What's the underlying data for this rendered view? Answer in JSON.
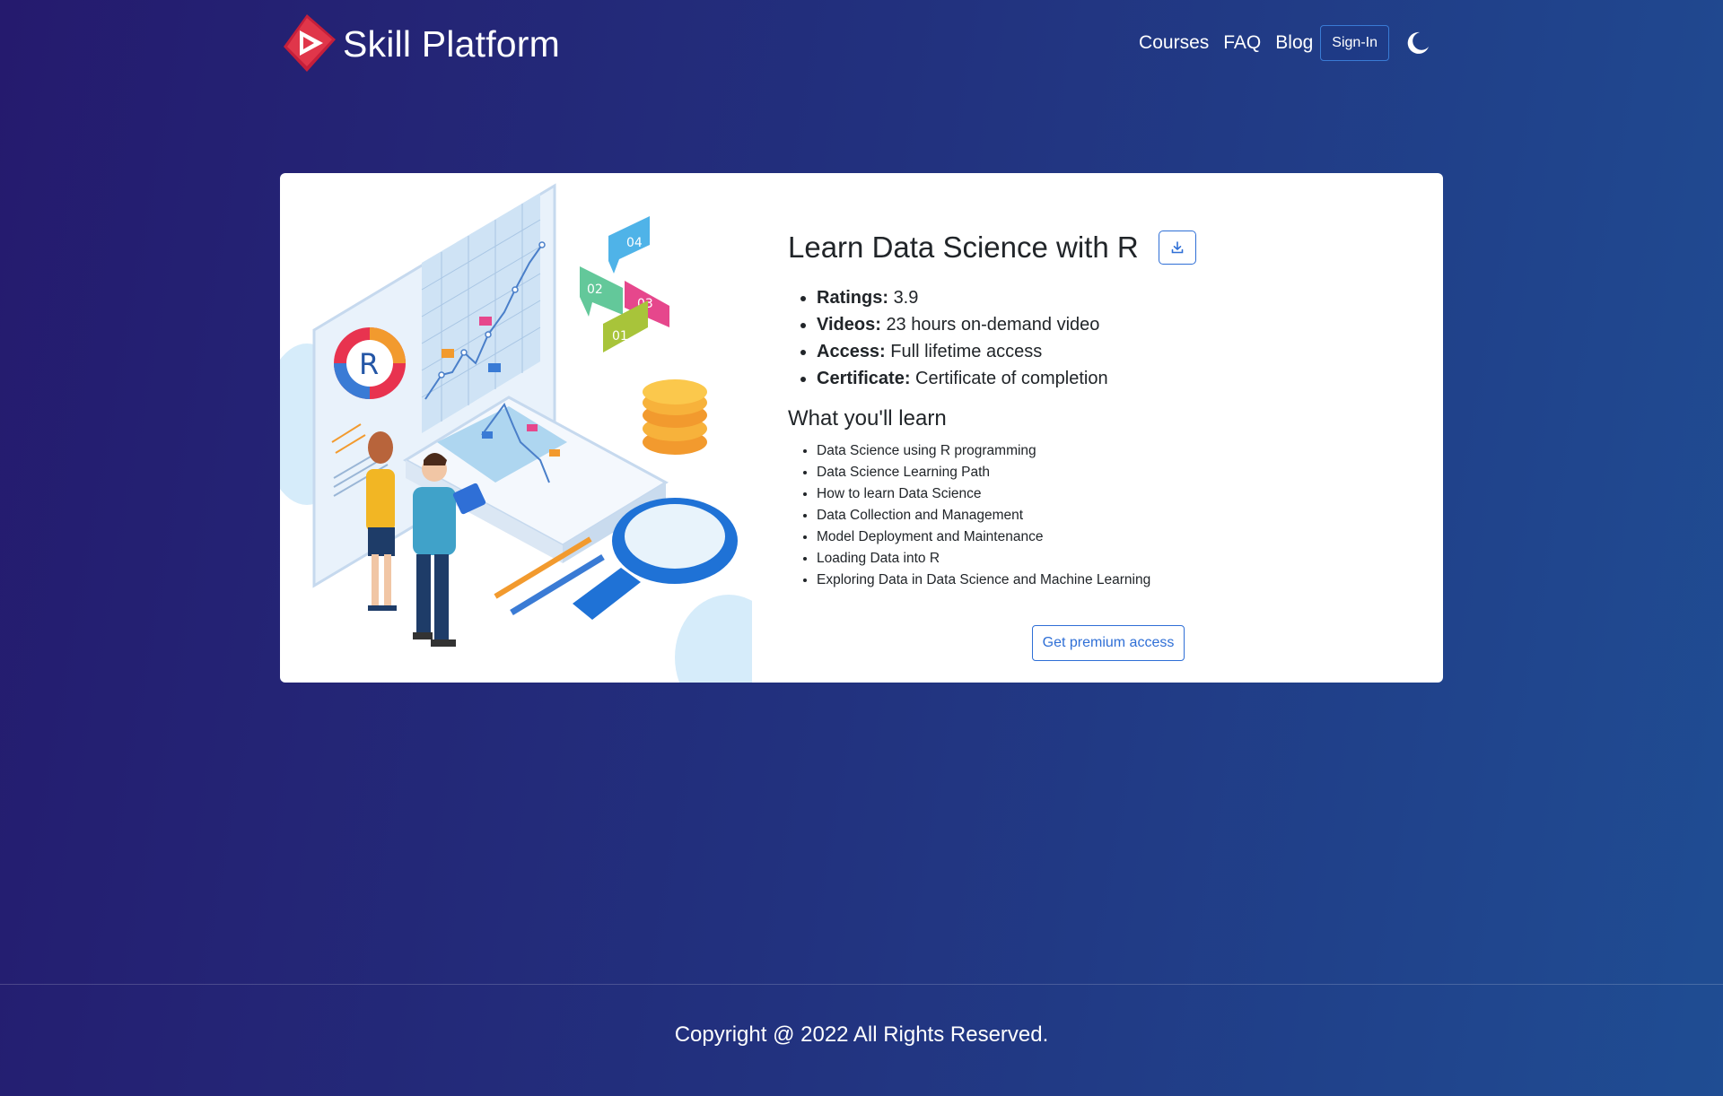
{
  "header": {
    "logo_text": "Skill Platform",
    "nav": [
      "Courses",
      "FAQ",
      "Blog"
    ],
    "signin_label": "Sign-In"
  },
  "course": {
    "title": "Learn Data Science with R",
    "facts": [
      {
        "label": "Ratings:",
        "value": "3.9"
      },
      {
        "label": "Videos:",
        "value": "23 hours on-demand video"
      },
      {
        "label": "Access:",
        "value": "Full lifetime access"
      },
      {
        "label": "Certificate:",
        "value": "Certificate of completion"
      }
    ],
    "learn_title": "What you'll learn",
    "learn_items": [
      "Data Science using R programming",
      "Data Science Learning Path",
      "How to learn Data Science",
      "Data Collection and Management",
      "Model Deployment and Maintenance",
      "Loading Data into R",
      "Exploring Data in Data Science and Machine Learning"
    ],
    "premium_label": "Get premium access",
    "illustration": {
      "logo_letter": "R",
      "bubbles": [
        "04",
        "02",
        "03",
        "01"
      ]
    }
  },
  "footer": {
    "copyright": "Copyright @ 2022 All Rights Reserved."
  },
  "colors": {
    "accent": "#2f6fd6",
    "logo_red": "#e0364a"
  }
}
